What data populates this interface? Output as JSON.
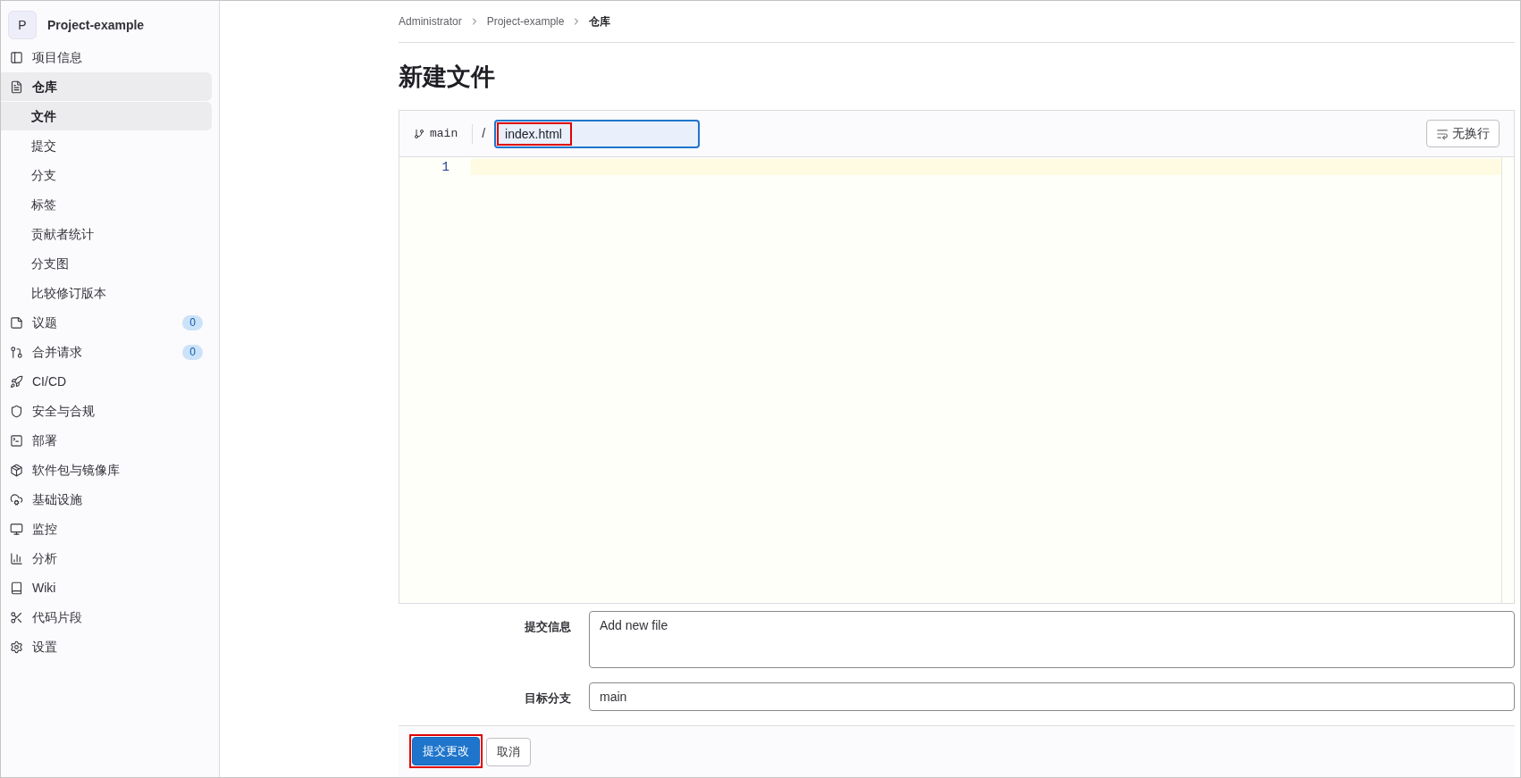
{
  "project": {
    "avatar": "P",
    "name": "Project-example"
  },
  "sidebar": {
    "items": [
      {
        "label": "项目信息",
        "selected": false
      },
      {
        "label": "仓库",
        "selected": true,
        "children": [
          {
            "label": "文件",
            "selected": true
          },
          {
            "label": "提交",
            "selected": false
          },
          {
            "label": "分支",
            "selected": false
          },
          {
            "label": "标签",
            "selected": false
          },
          {
            "label": "贡献者统计",
            "selected": false
          },
          {
            "label": "分支图",
            "selected": false
          },
          {
            "label": "比较修订版本",
            "selected": false
          }
        ]
      },
      {
        "label": "议题",
        "selected": false,
        "badge": "0"
      },
      {
        "label": "合并请求",
        "selected": false,
        "badge": "0"
      },
      {
        "label": "CI/CD",
        "selected": false
      },
      {
        "label": "安全与合规",
        "selected": false
      },
      {
        "label": "部署",
        "selected": false
      },
      {
        "label": "软件包与镜像库",
        "selected": false
      },
      {
        "label": "基础设施",
        "selected": false
      },
      {
        "label": "监控",
        "selected": false
      },
      {
        "label": "分析",
        "selected": false
      },
      {
        "label": "Wiki",
        "selected": false
      },
      {
        "label": "代码片段",
        "selected": false
      },
      {
        "label": "设置",
        "selected": false
      }
    ]
  },
  "breadcrumb": [
    "Administrator",
    "Project-example",
    "仓库"
  ],
  "title": "新建文件",
  "editor": {
    "branch": "main",
    "separator": "/",
    "file_name": "index.html",
    "wrap_button": "无换行",
    "line_numbers": [
      "1"
    ]
  },
  "commit_form": [
    {
      "kind": "textarea",
      "label": "提交信息",
      "value": "Add new file"
    },
    {
      "kind": "input",
      "label": "目标分支",
      "value": "main"
    }
  ],
  "buttons": [
    {
      "label": "提交更改",
      "kind": "primary",
      "highlighted": true
    },
    {
      "label": "取消",
      "kind": "secondary",
      "highlighted": false
    }
  ]
}
